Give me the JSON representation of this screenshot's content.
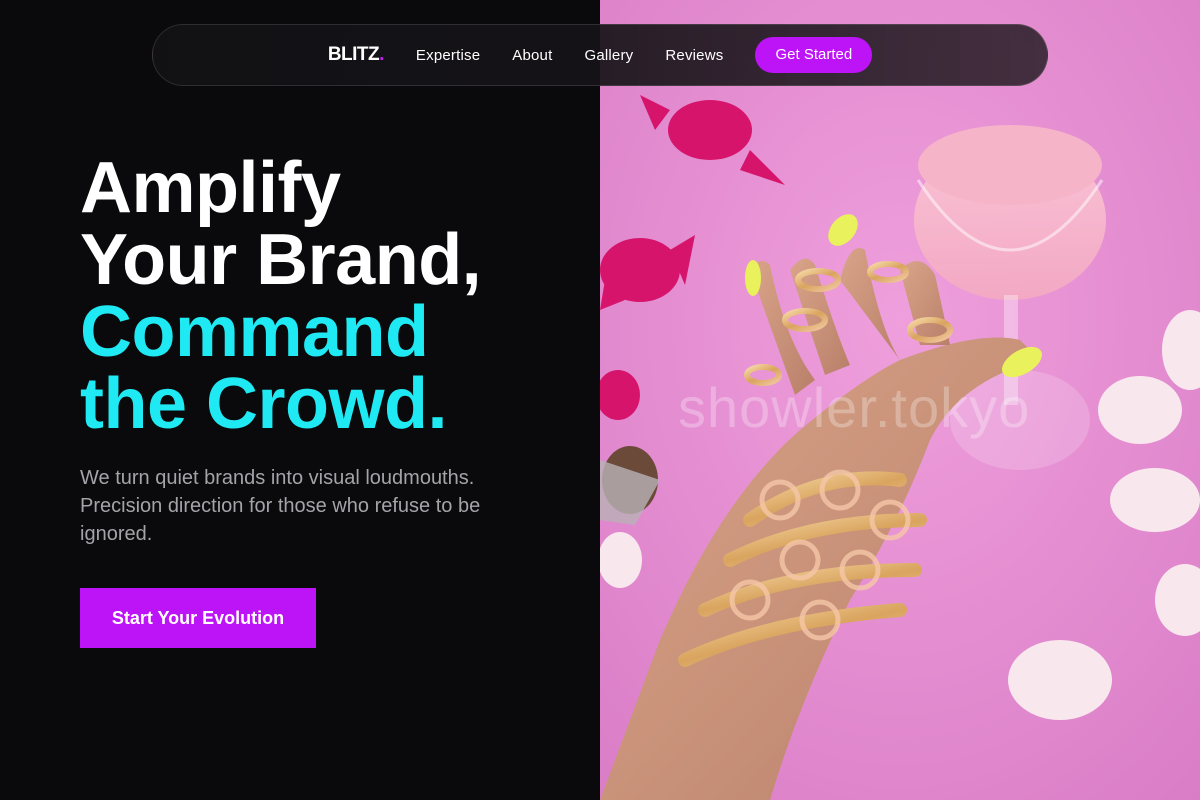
{
  "brand": {
    "name": "BLITZ",
    "dot": "."
  },
  "nav": {
    "links": [
      "Expertise",
      "About",
      "Gallery",
      "Reviews"
    ],
    "cta_label": "Get Started"
  },
  "hero": {
    "headline_lines": [
      "Amplify",
      "Your Brand,"
    ],
    "accent_lines": [
      "Command",
      "the Crowd."
    ],
    "subtitle_lines": [
      "We turn quiet brands into visual loudmouths.",
      "Precision direction for those who refuse to be",
      "ignored."
    ],
    "button_label": "Start Your Evolution"
  },
  "image": {
    "watermark": "showler.tokyo",
    "description_icon": "hand-with-gold-jewelry-and-pink-cocktail-photo"
  },
  "colors": {
    "background": "#0a0a0c",
    "accent_purple": "#bd13f7",
    "accent_cyan": "#1fe9f2",
    "muted_text": "#a3a3a9",
    "image_pink": "#e68fcf"
  }
}
